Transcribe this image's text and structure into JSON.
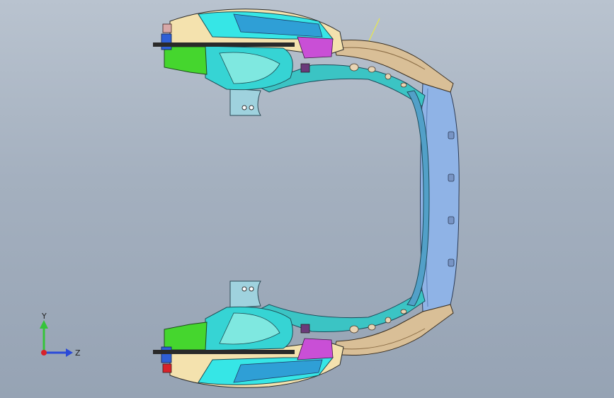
{
  "viewport": {
    "background_top": "#b9c3cf",
    "background_bottom": "#96a3b4"
  },
  "model": {
    "description_icon": "cad-assembly-icon",
    "colors": {
      "tan_frame": "#d9bf97",
      "teal": "#3bc4c4",
      "cyan": "#36e6e6",
      "blue": "#2f7fd6",
      "light_blue_panel": "#8fb3e6",
      "green": "#45d62e",
      "cream": "#f4e2ae",
      "magenta": "#c94fd6",
      "red": "#d8222a",
      "dark": "#2a2a2a",
      "yellow_line": "#e8e84a"
    }
  },
  "triad": {
    "y_label": "Y",
    "z_label": "Z",
    "y_color": "#35c43a",
    "z_color": "#2a4ad8",
    "origin_color": "#d8222a"
  }
}
